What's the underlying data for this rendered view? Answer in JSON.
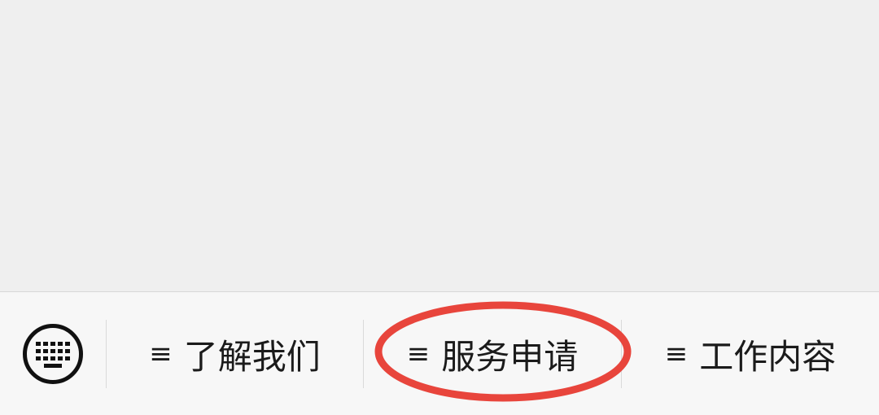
{
  "chat": {},
  "menu_bar": {
    "keyboard_icon": "keyboard-icon",
    "items": [
      {
        "icon": "menu-lines-icon",
        "glyph": "≡",
        "label": "了解我们"
      },
      {
        "icon": "menu-lines-icon",
        "glyph": "≡",
        "label": "服务申请"
      },
      {
        "icon": "menu-lines-icon",
        "glyph": "≡",
        "label": "工作内容"
      }
    ]
  },
  "annotation": {
    "shape": "ellipse",
    "color": "#e8453c",
    "target": "服务申请"
  }
}
